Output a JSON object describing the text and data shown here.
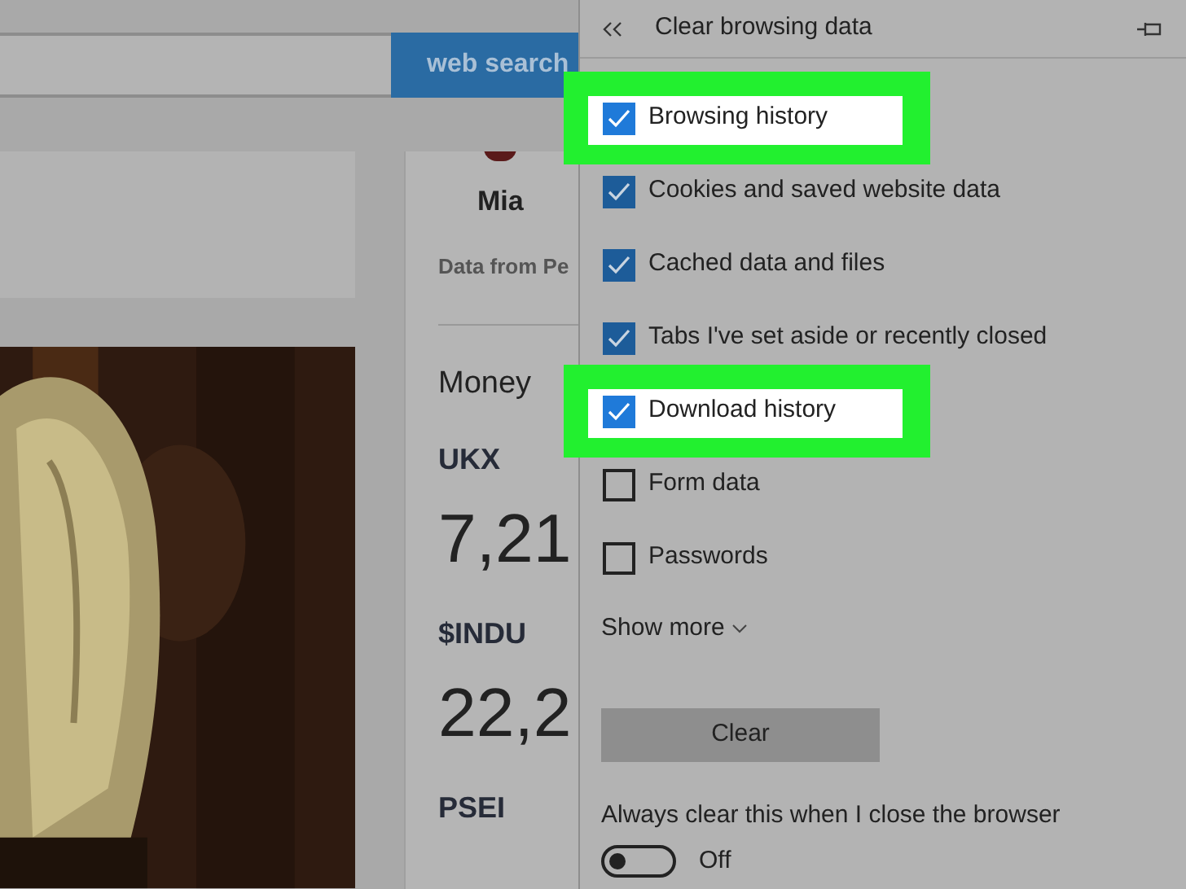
{
  "page": {
    "search_button": "web search",
    "profile_name": "Mia",
    "data_source": "Data from Pe",
    "money_heading": "Money",
    "stocks": [
      {
        "symbol": "UKX",
        "value": "7,21"
      },
      {
        "symbol": "$INDU",
        "value": "22,2"
      },
      {
        "symbol": "PSEI"
      }
    ]
  },
  "panel": {
    "title": "Clear browsing data",
    "options": [
      {
        "label": "Browsing history",
        "checked": true,
        "highlighted": true
      },
      {
        "label": "Cookies and saved website data",
        "checked": true,
        "highlighted": false
      },
      {
        "label": "Cached data and files",
        "checked": true,
        "highlighted": false
      },
      {
        "label": "Tabs I've set aside or recently closed",
        "checked": true,
        "highlighted": false
      },
      {
        "label": "Download history",
        "checked": true,
        "highlighted": true
      },
      {
        "label": "Form data",
        "checked": false,
        "highlighted": false
      },
      {
        "label": "Passwords",
        "checked": false,
        "highlighted": false
      }
    ],
    "show_more": "Show more",
    "clear_button": "Clear",
    "always_clear": {
      "label": "Always clear this when I close the browser",
      "on": false,
      "state_text": "Off"
    }
  }
}
